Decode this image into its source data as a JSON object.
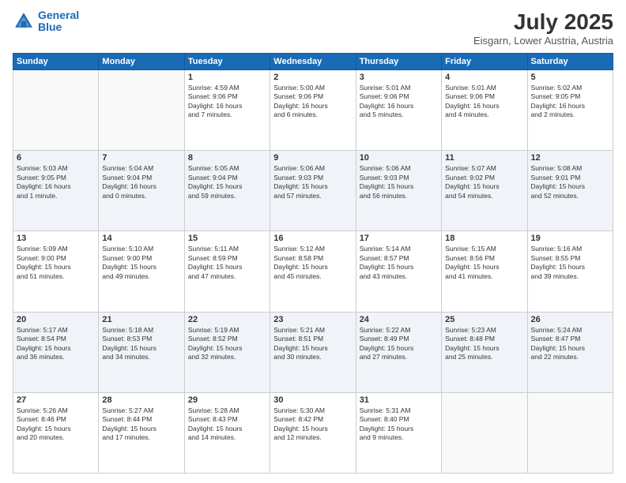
{
  "header": {
    "logo_line1": "General",
    "logo_line2": "Blue",
    "month": "July 2025",
    "location": "Eisgarn, Lower Austria, Austria"
  },
  "weekdays": [
    "Sunday",
    "Monday",
    "Tuesday",
    "Wednesday",
    "Thursday",
    "Friday",
    "Saturday"
  ],
  "weeks": [
    [
      {
        "day": "",
        "info": ""
      },
      {
        "day": "",
        "info": ""
      },
      {
        "day": "1",
        "info": "Sunrise: 4:59 AM\nSunset: 9:06 PM\nDaylight: 16 hours\nand 7 minutes."
      },
      {
        "day": "2",
        "info": "Sunrise: 5:00 AM\nSunset: 9:06 PM\nDaylight: 16 hours\nand 6 minutes."
      },
      {
        "day": "3",
        "info": "Sunrise: 5:01 AM\nSunset: 9:06 PM\nDaylight: 16 hours\nand 5 minutes."
      },
      {
        "day": "4",
        "info": "Sunrise: 5:01 AM\nSunset: 9:06 PM\nDaylight: 16 hours\nand 4 minutes."
      },
      {
        "day": "5",
        "info": "Sunrise: 5:02 AM\nSunset: 9:05 PM\nDaylight: 16 hours\nand 2 minutes."
      }
    ],
    [
      {
        "day": "6",
        "info": "Sunrise: 5:03 AM\nSunset: 9:05 PM\nDaylight: 16 hours\nand 1 minute."
      },
      {
        "day": "7",
        "info": "Sunrise: 5:04 AM\nSunset: 9:04 PM\nDaylight: 16 hours\nand 0 minutes."
      },
      {
        "day": "8",
        "info": "Sunrise: 5:05 AM\nSunset: 9:04 PM\nDaylight: 15 hours\nand 59 minutes."
      },
      {
        "day": "9",
        "info": "Sunrise: 5:06 AM\nSunset: 9:03 PM\nDaylight: 15 hours\nand 57 minutes."
      },
      {
        "day": "10",
        "info": "Sunrise: 5:06 AM\nSunset: 9:03 PM\nDaylight: 15 hours\nand 56 minutes."
      },
      {
        "day": "11",
        "info": "Sunrise: 5:07 AM\nSunset: 9:02 PM\nDaylight: 15 hours\nand 54 minutes."
      },
      {
        "day": "12",
        "info": "Sunrise: 5:08 AM\nSunset: 9:01 PM\nDaylight: 15 hours\nand 52 minutes."
      }
    ],
    [
      {
        "day": "13",
        "info": "Sunrise: 5:09 AM\nSunset: 9:00 PM\nDaylight: 15 hours\nand 51 minutes."
      },
      {
        "day": "14",
        "info": "Sunrise: 5:10 AM\nSunset: 9:00 PM\nDaylight: 15 hours\nand 49 minutes."
      },
      {
        "day": "15",
        "info": "Sunrise: 5:11 AM\nSunset: 8:59 PM\nDaylight: 15 hours\nand 47 minutes."
      },
      {
        "day": "16",
        "info": "Sunrise: 5:12 AM\nSunset: 8:58 PM\nDaylight: 15 hours\nand 45 minutes."
      },
      {
        "day": "17",
        "info": "Sunrise: 5:14 AM\nSunset: 8:57 PM\nDaylight: 15 hours\nand 43 minutes."
      },
      {
        "day": "18",
        "info": "Sunrise: 5:15 AM\nSunset: 8:56 PM\nDaylight: 15 hours\nand 41 minutes."
      },
      {
        "day": "19",
        "info": "Sunrise: 5:16 AM\nSunset: 8:55 PM\nDaylight: 15 hours\nand 39 minutes."
      }
    ],
    [
      {
        "day": "20",
        "info": "Sunrise: 5:17 AM\nSunset: 8:54 PM\nDaylight: 15 hours\nand 36 minutes."
      },
      {
        "day": "21",
        "info": "Sunrise: 5:18 AM\nSunset: 8:53 PM\nDaylight: 15 hours\nand 34 minutes."
      },
      {
        "day": "22",
        "info": "Sunrise: 5:19 AM\nSunset: 8:52 PM\nDaylight: 15 hours\nand 32 minutes."
      },
      {
        "day": "23",
        "info": "Sunrise: 5:21 AM\nSunset: 8:51 PM\nDaylight: 15 hours\nand 30 minutes."
      },
      {
        "day": "24",
        "info": "Sunrise: 5:22 AM\nSunset: 8:49 PM\nDaylight: 15 hours\nand 27 minutes."
      },
      {
        "day": "25",
        "info": "Sunrise: 5:23 AM\nSunset: 8:48 PM\nDaylight: 15 hours\nand 25 minutes."
      },
      {
        "day": "26",
        "info": "Sunrise: 5:24 AM\nSunset: 8:47 PM\nDaylight: 15 hours\nand 22 minutes."
      }
    ],
    [
      {
        "day": "27",
        "info": "Sunrise: 5:26 AM\nSunset: 8:46 PM\nDaylight: 15 hours\nand 20 minutes."
      },
      {
        "day": "28",
        "info": "Sunrise: 5:27 AM\nSunset: 8:44 PM\nDaylight: 15 hours\nand 17 minutes."
      },
      {
        "day": "29",
        "info": "Sunrise: 5:28 AM\nSunset: 8:43 PM\nDaylight: 15 hours\nand 14 minutes."
      },
      {
        "day": "30",
        "info": "Sunrise: 5:30 AM\nSunset: 8:42 PM\nDaylight: 15 hours\nand 12 minutes."
      },
      {
        "day": "31",
        "info": "Sunrise: 5:31 AM\nSunset: 8:40 PM\nDaylight: 15 hours\nand 9 minutes."
      },
      {
        "day": "",
        "info": ""
      },
      {
        "day": "",
        "info": ""
      }
    ]
  ]
}
